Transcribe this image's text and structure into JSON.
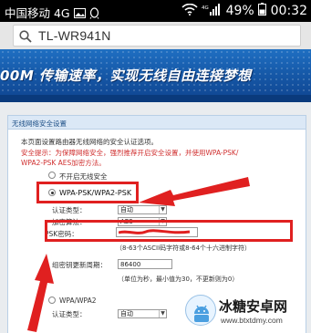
{
  "status_bar": {
    "carrier": "中国移动 4G",
    "battery": "49%",
    "time": "00:32"
  },
  "url_bar": {
    "text": "TL-WR941N"
  },
  "banner": {
    "slogan": "00M 传输速率，实现无线自由连接梦想"
  },
  "panel": {
    "title": "无线网络安全设置",
    "intro": "本页面设置路由器无线网络的安全认证选项。",
    "warning_line1": "安全提示：为保障网络安全，强烈推荐开启安全设置，并使用WPA-PSK/",
    "warning_line2": "WPA2-PSK AES加密方法。",
    "option_off": "不开启无线安全",
    "option_wpapsk": "WPA-PSK/WPA2-PSK",
    "auth_label": "认证类型：",
    "auth_value": "自动",
    "enc_label": "加密算法：",
    "enc_value": "AES",
    "psk_label": "PSK密码：",
    "psk_hint": "（8-63个ASCII码字符或8-64个十六进制字符）",
    "renew_label": "组密钥更新周期：",
    "renew_value": "86400",
    "renew_hint": "（单位为秒，最小值为30，不更新则为0）",
    "option_wpa": "WPA/WPA2",
    "auth_label2": "认证类型：",
    "auth_value2": "自动"
  },
  "watermark": {
    "brand": "冰糖安卓网",
    "url": "www.btxtdmy.com"
  },
  "colors": {
    "highlight": "#e02020",
    "banner": "#1557a6",
    "panel_header": "#dbe8f6"
  }
}
